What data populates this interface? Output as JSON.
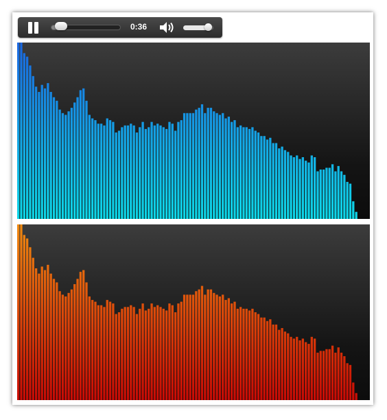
{
  "player": {
    "time": "0:36",
    "progress": 0.14,
    "volume": 0.85
  },
  "spectrum": {
    "top_colors": [
      "#1a66e0",
      "#0ed8e8"
    ],
    "bottom_colors": [
      "#f08a10",
      "#c80a05"
    ],
    "levels": [
      1.0,
      1.0,
      0.94,
      0.92,
      0.87,
      0.81,
      0.75,
      0.72,
      0.76,
      0.74,
      0.77,
      0.72,
      0.69,
      0.67,
      0.62,
      0.6,
      0.59,
      0.61,
      0.63,
      0.66,
      0.69,
      0.73,
      0.74,
      0.67,
      0.59,
      0.57,
      0.56,
      0.54,
      0.54,
      0.53,
      0.57,
      0.56,
      0.55,
      0.49,
      0.5,
      0.52,
      0.53,
      0.53,
      0.54,
      0.53,
      0.49,
      0.52,
      0.55,
      0.51,
      0.52,
      0.55,
      0.53,
      0.54,
      0.53,
      0.52,
      0.51,
      0.55,
      0.54,
      0.5,
      0.55,
      0.56,
      0.6,
      0.6,
      0.6,
      0.6,
      0.62,
      0.63,
      0.65,
      0.6,
      0.63,
      0.63,
      0.61,
      0.6,
      0.59,
      0.6,
      0.57,
      0.58,
      0.55,
      0.56,
      0.52,
      0.53,
      0.52,
      0.52,
      0.51,
      0.52,
      0.5,
      0.49,
      0.47,
      0.47,
      0.45,
      0.46,
      0.43,
      0.43,
      0.4,
      0.41,
      0.39,
      0.38,
      0.36,
      0.35,
      0.36,
      0.34,
      0.35,
      0.33,
      0.32,
      0.36,
      0.35,
      0.27,
      0.28,
      0.28,
      0.29,
      0.29,
      0.31,
      0.27,
      0.3,
      0.27,
      0.25,
      0.21,
      0.2,
      0.1,
      0.04
    ]
  }
}
